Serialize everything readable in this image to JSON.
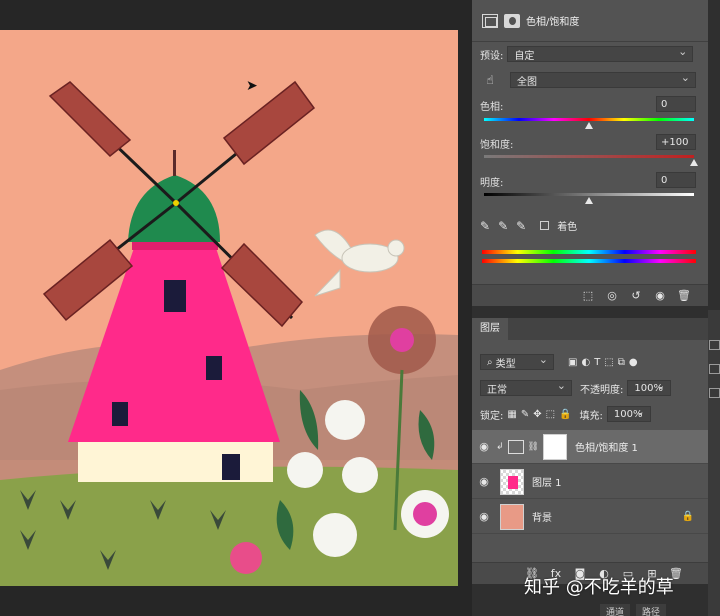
{
  "properties": {
    "title": "色相/饱和度",
    "preset_label": "预设:",
    "preset_value": "自定",
    "channel_value": "全图",
    "hue_label": "色相:",
    "hue_value": "0",
    "saturation_label": "饱和度:",
    "saturation_value": "+100",
    "lightness_label": "明度:",
    "lightness_value": "0",
    "colorize_label": "着色",
    "hue_pos": 0.5,
    "saturation_pos": 1.0,
    "lightness_pos": 0.5
  },
  "layers": {
    "tab_label": "图层",
    "filter_value": "类型",
    "blend_mode": "正常",
    "opacity_label": "不透明度:",
    "opacity_value": "100%",
    "lock_label": "锁定:",
    "fill_label": "填充:",
    "fill_value": "100%",
    "items": [
      {
        "name": "色相/饱和度 1",
        "selected": true
      },
      {
        "name": "图层 1",
        "selected": false
      },
      {
        "name": "背景",
        "selected": false
      }
    ]
  },
  "watermark": "知乎 @不吃羊的草",
  "bottom_tabs": [
    "通道",
    "路径"
  ],
  "colors": {
    "canvas_bg": "#f4a789",
    "windmill_body": "#ff2a8a",
    "roof": "#1f8a4e",
    "ground": "#8aa14a",
    "panel": "#535353"
  }
}
